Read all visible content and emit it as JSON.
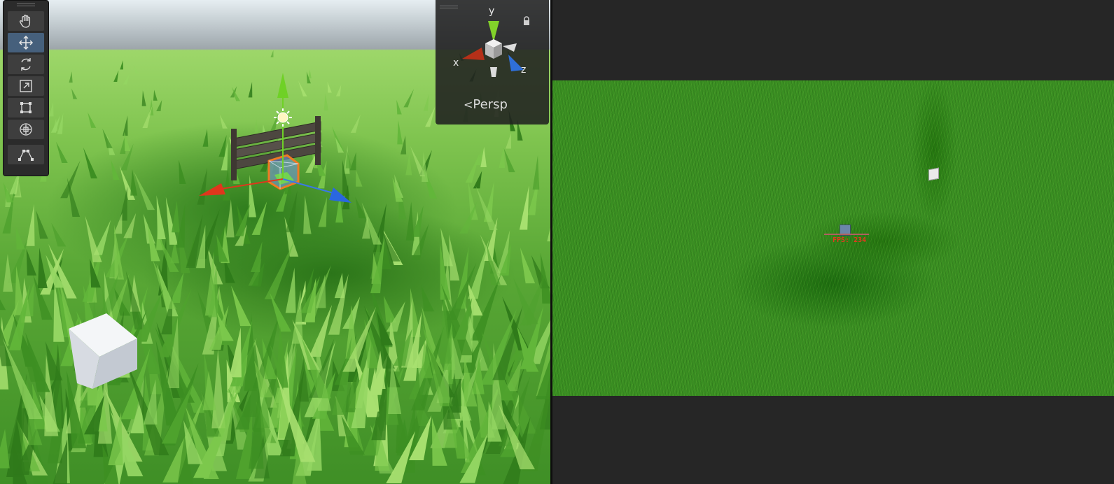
{
  "scene_view": {
    "tools": [
      {
        "name": "hand-tool",
        "icon": "hand-icon",
        "active": false
      },
      {
        "name": "move-tool",
        "icon": "move-arrows-icon",
        "active": true
      },
      {
        "name": "rotate-tool",
        "icon": "rotate-icon",
        "active": false
      },
      {
        "name": "scale-tool",
        "icon": "scale-icon",
        "active": false
      },
      {
        "name": "rect-tool",
        "icon": "rect-transform-icon",
        "active": false
      },
      {
        "name": "transform-tool",
        "icon": "transform-icon",
        "active": false
      },
      {
        "name": "custom-tool",
        "icon": "custom-editor-tool-icon",
        "active": false
      }
    ],
    "gizmo": {
      "y_label": "y",
      "x_label": "x",
      "z_label": "z",
      "projection_label": "Persp",
      "colors": {
        "x": "#e0361c",
        "y": "#82d12a",
        "z": "#3a78e6"
      }
    }
  },
  "game_view": {
    "fps_text": "FPS: 234"
  },
  "colors": {
    "grass_light": "#9ed76a",
    "grass_dark": "#3a8f22",
    "selection_outline": "#f07a22"
  }
}
